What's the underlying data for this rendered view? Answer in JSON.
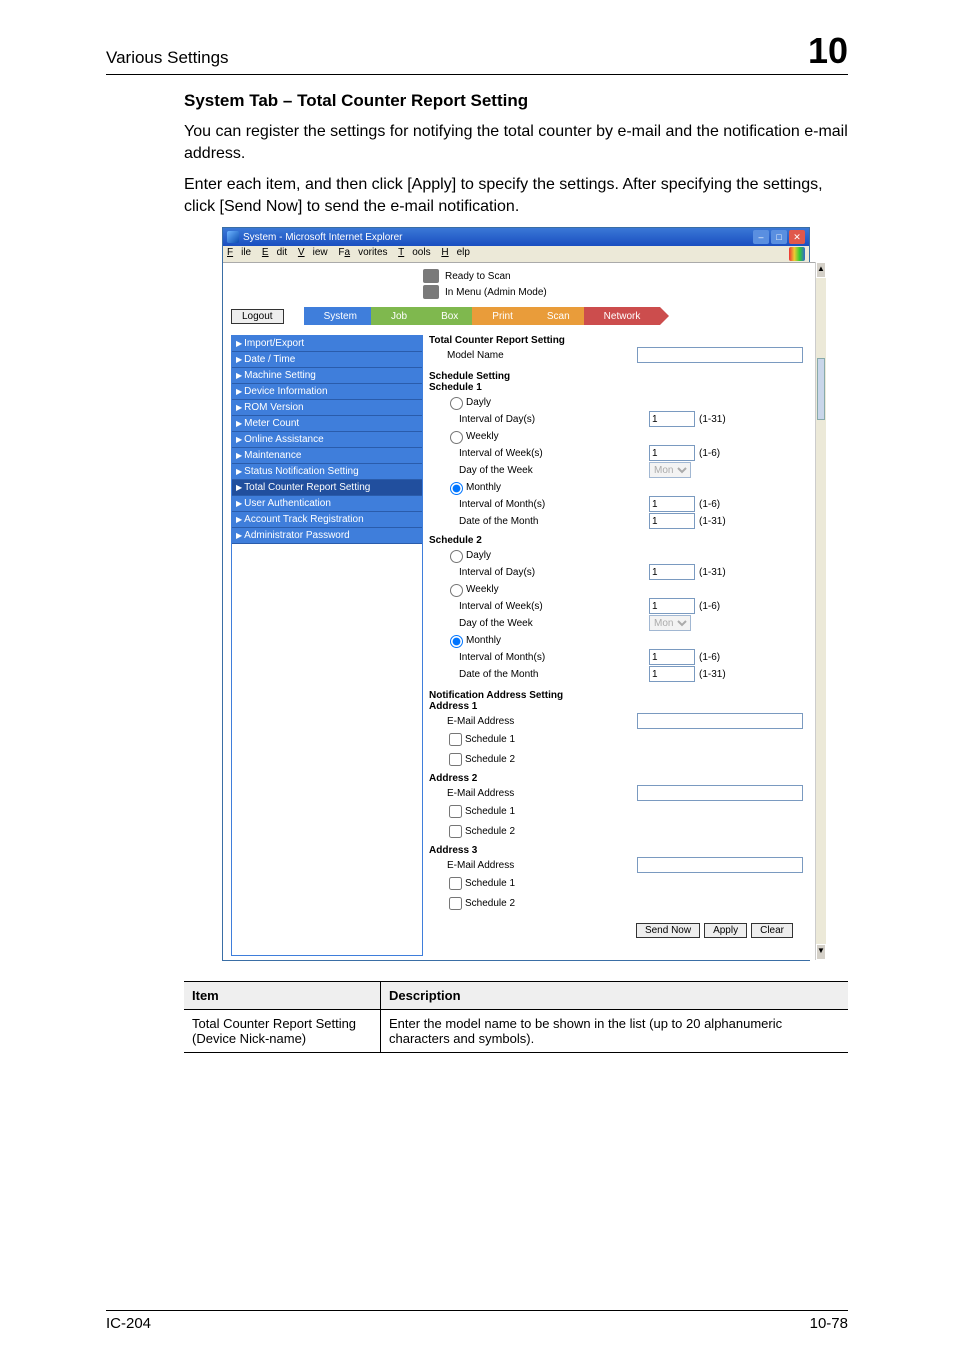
{
  "header": {
    "section": "Various Settings",
    "chapter_number": "10"
  },
  "intro": {
    "heading": "System Tab – Total Counter Report Setting",
    "p1": "You can register the settings for notifying the total counter by e-mail and the notification e-mail address.",
    "p2": "Enter each item, and then click [Apply] to specify the settings. After specifying the settings, click [Send Now] to send the e-mail notification."
  },
  "shot": {
    "titlebar": "System - Microsoft Internet Explorer",
    "menus": {
      "file": "File",
      "edit": "Edit",
      "view": "View",
      "favorites": "Favorites",
      "tools": "Tools",
      "help": "Help"
    },
    "status": {
      "ready": "Ready to Scan",
      "mode": "In Menu (Admin Mode)"
    },
    "logout": "Logout",
    "tabs": {
      "system": "System",
      "job": "Job",
      "box": "Box",
      "print": "Print",
      "scan": "Scan",
      "network": "Network"
    },
    "nav": [
      "Import/Export",
      "Date / Time",
      "Machine Setting",
      "Device Information",
      "ROM Version",
      "Meter Count",
      "Online Assistance",
      "Maintenance",
      "Status Notification Setting",
      "Total Counter Report Setting",
      "User Authentication",
      "Account Track Registration",
      "Administrator Password"
    ],
    "pane": {
      "tcrs_title": "Total Counter Report Setting",
      "model_name": "Model Name",
      "schedule_setting": "Schedule Setting",
      "schedule1": "Schedule 1",
      "schedule2": "Schedule 2",
      "daily": "Dayly",
      "weekly": "Weekly",
      "monthly": "Monthly",
      "int_day": "Interval of Day(s)",
      "int_week": "Interval of Week(s)",
      "dow": "Day of the Week",
      "int_month": "Interval of Month(s)",
      "dom": "Date of the Month",
      "nas_title": "Notification Address Setting",
      "addr1": "Address 1",
      "addr2": "Address 2",
      "addr3": "Address 3",
      "email": "E-Mail Address",
      "sch1": "Schedule 1",
      "sch2": "Schedule 2",
      "btn_send": "Send Now",
      "btn_apply": "Apply",
      "btn_clear": "Clear",
      "vals": {
        "day1": "1",
        "r_day": "(1-31)",
        "week1": "1",
        "r_week": "(1-6)",
        "dow1": "Mon",
        "month1": "1",
        "r_month": "(1-6)",
        "dom1": "1",
        "r_dom": "(1-31)"
      }
    }
  },
  "table": {
    "h_item": "Item",
    "h_desc": "Description",
    "r1_item": "Total Counter Report Setting (Device Nick-name)",
    "r1_desc": "Enter the model name to be shown in the list (up to 20 alphanumeric characters and symbols)."
  },
  "footer": {
    "left": "IC-204",
    "right": "10-78"
  }
}
